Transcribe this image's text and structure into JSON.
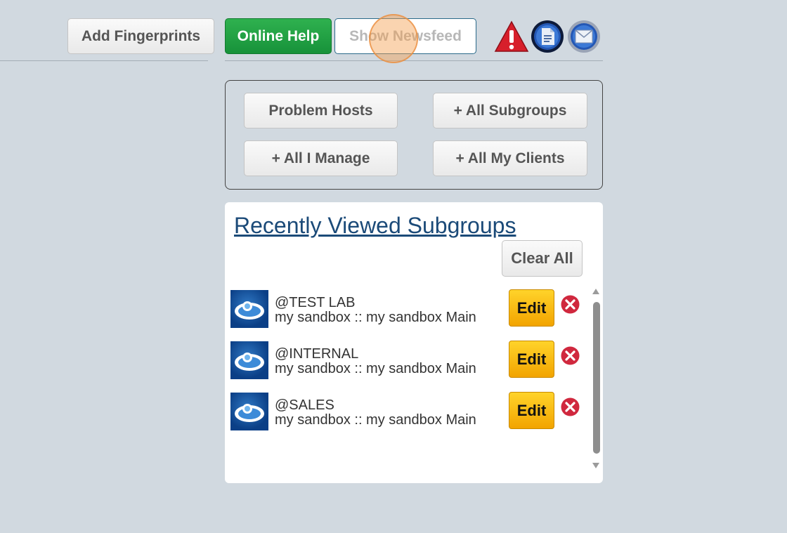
{
  "toolbar": {
    "add_fingerprints": "Add Fingerprints",
    "online_help": "Online Help",
    "show_newsfeed": "Show Newsfeed",
    "icons": [
      "alert-icon",
      "document-icon",
      "mail-icon"
    ]
  },
  "quick_filters": {
    "problem_hosts": "Problem Hosts",
    "all_subgroups": "+ All Subgroups",
    "all_i_manage": "+ All I Manage",
    "all_my_clients": "+ All My Clients"
  },
  "recent": {
    "title": "Recently Viewed Subgroups",
    "clear_all": "Clear All",
    "items": [
      {
        "name": "@TEST LAB",
        "path": "my sandbox :: my sandbox Main",
        "edit": "Edit"
      },
      {
        "name": "@INTERNAL",
        "path": "my sandbox :: my sandbox Main",
        "edit": "Edit"
      },
      {
        "name": "@SALES",
        "path": "my sandbox :: my sandbox Main",
        "edit": "Edit"
      }
    ]
  },
  "colors": {
    "background": "#d1d9e0",
    "online_help": "#1f9c42",
    "edit": "#f7bd14",
    "remove": "#d0283e",
    "link": "#1b4a78"
  }
}
